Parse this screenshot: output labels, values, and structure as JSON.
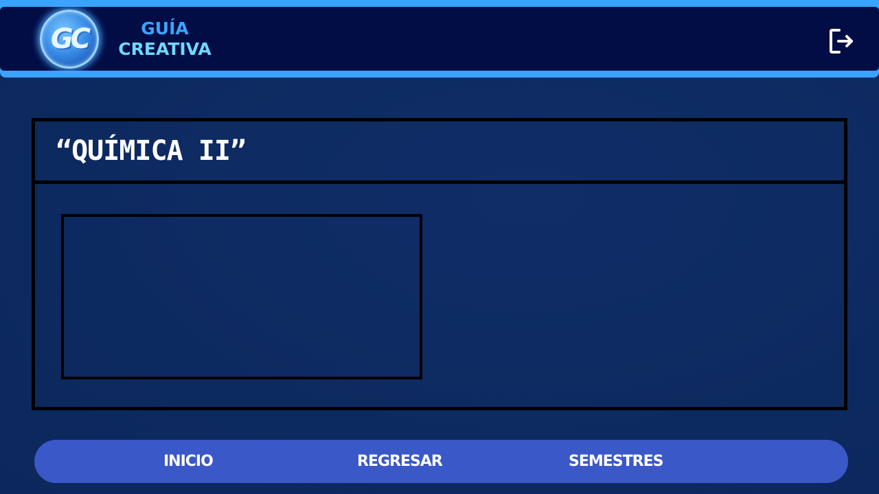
{
  "header": {
    "logo_text": "GC",
    "brand_line1": "GUÍA",
    "brand_line2": "CREATIVA",
    "logout_icon": "logout-icon"
  },
  "main": {
    "title": "“QUÍMICA II”"
  },
  "nav": {
    "items": [
      {
        "label": "INICIO"
      },
      {
        "label": "REGRESAR"
      },
      {
        "label": "SEMESTRES"
      }
    ]
  },
  "colors": {
    "background": "#0f2d66",
    "header_border": "#3aa3ff",
    "header_bg": "#020d45",
    "brand_top": "#3aa6ff",
    "brand_bottom": "#6ed9ff",
    "nav_bg": "#3a58c8"
  }
}
